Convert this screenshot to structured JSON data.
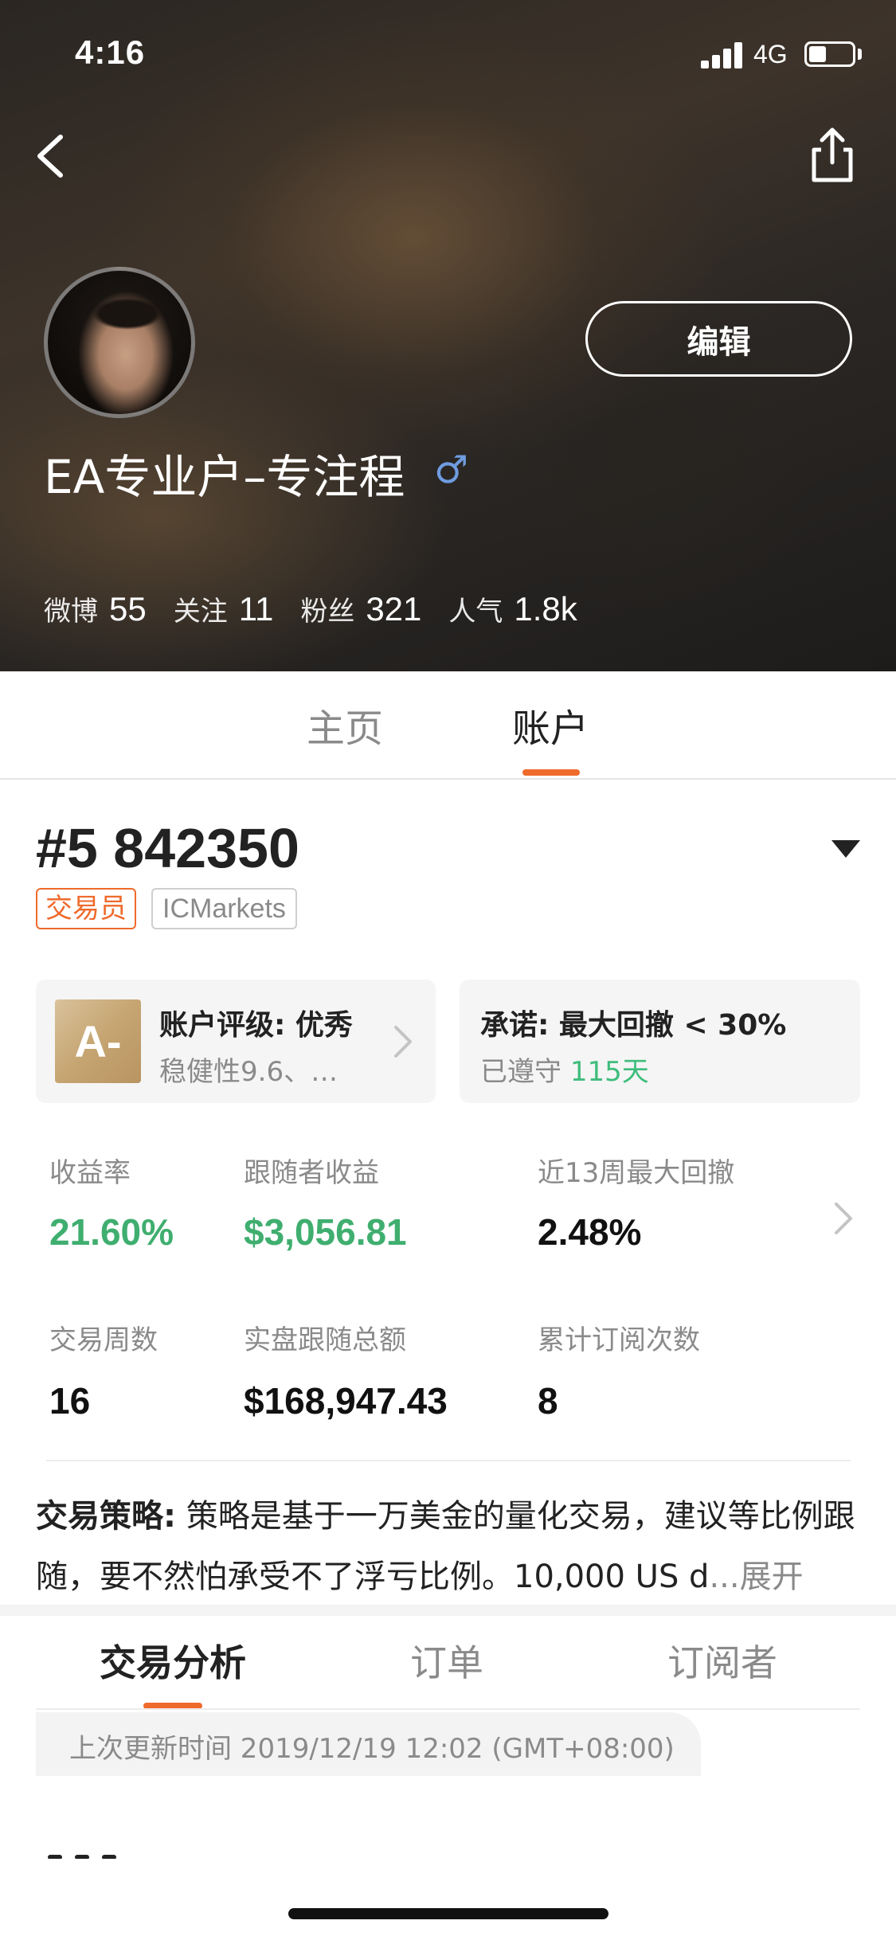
{
  "status_bar": {
    "time": "4:16",
    "network": "4G",
    "battery_level": 0.4
  },
  "header": {
    "back_icon": "chevron-left-icon",
    "share_icon": "share-icon",
    "edit_label": "编辑",
    "user_name": "EA专业户–专注程",
    "gender_icon": "♂",
    "stats": [
      {
        "label": "微博",
        "value": "55"
      },
      {
        "label": "关注",
        "value": "11"
      },
      {
        "label": "粉丝",
        "value": "321"
      },
      {
        "label": "人气",
        "value": "1.8k"
      }
    ]
  },
  "main_tabs": [
    {
      "label": "主页"
    },
    {
      "label": "账户"
    }
  ],
  "account": {
    "number": "#5 842350",
    "tag_trader": "交易员",
    "tag_broker": "ICMarkets",
    "rating_card": {
      "grade": "A-",
      "title": "账户评级: 优秀",
      "subtitle": "稳健性9.6、…"
    },
    "commitment_card": {
      "title": "承诺: 最大回撤 < 30%",
      "kept_prefix": "已遵守 ",
      "kept_days": "115天"
    },
    "metrics": [
      {
        "label": "收益率",
        "value": "21.60%"
      },
      {
        "label": "跟随者收益",
        "value": "$3,056.81"
      },
      {
        "label": "近13周最大回撤",
        "value": "2.48%"
      },
      {
        "label": "交易周数",
        "value": "16"
      },
      {
        "label": "实盘跟随总额",
        "value": "$168,947.43"
      },
      {
        "label": "累计订阅次数",
        "value": "8"
      }
    ],
    "strategy": {
      "label": "交易策略:",
      "text": " 策略是基于一万美金的量化交易，建议等比例跟随，要不然怕承受不了浮亏比例。10,000 US d",
      "ellipsis": "...",
      "expand": "展开"
    }
  },
  "sub_tabs": [
    {
      "label": "交易分析"
    },
    {
      "label": "订单"
    },
    {
      "label": "订阅者"
    }
  ],
  "update_text": "上次更新时间 2019/12/19 12:02 (GMT+08:00)",
  "colors": {
    "accent": "#ef6a2b",
    "positive": "#3fae6f",
    "commit_green": "#3fbd7c",
    "gender": "#6f9ce0"
  }
}
